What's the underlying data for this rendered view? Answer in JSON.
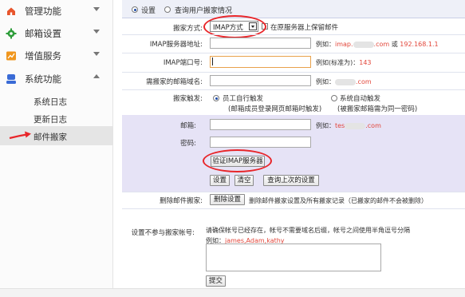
{
  "sidebar": {
    "items": [
      {
        "label": "管理功能",
        "icon": "home-icon",
        "color": "#e8552c"
      },
      {
        "label": "邮箱设置",
        "icon": "gear-icon",
        "color": "#2e9d3a"
      },
      {
        "label": "增值服务",
        "icon": "chart-icon",
        "color": "#f0961d"
      },
      {
        "label": "系统功能",
        "icon": "user-icon",
        "color": "#3a6bd6"
      }
    ],
    "subitems": [
      {
        "label": "系统日志"
      },
      {
        "label": "更新日志"
      },
      {
        "label": "邮件搬家"
      }
    ]
  },
  "tabs": {
    "settings": "设置",
    "query": "查询用户搬家情况"
  },
  "form": {
    "method_label": "搬家方式:",
    "method_value": "IMAP方式",
    "keep_mail_label": "在原服务器上保留邮件",
    "server_label": "IMAP服务器地址:",
    "server_hint_prefix": "例如：",
    "server_hint_example1": "imap.",
    "server_hint_sep": "或",
    "server_hint_example2": "192.168.1.1",
    "port_label": "IMAP端口号:",
    "port_hint_prefix": "例如(标准为)：",
    "port_hint_value": "143",
    "domain_label": "需搬家的邮箱域名:",
    "domain_hint_prefix": "例如：",
    "trigger_label": "搬家触发:",
    "trigger_option1": "员工自行触发",
    "trigger_option1_note": "(邮箱成员登录网页邮箱时触发)",
    "trigger_option2": "系统自动触发",
    "trigger_option2_note": "(被搬家邮箱需为同一密码)",
    "email_label": "邮箱:",
    "email_hint_prefix": "例如：",
    "email_hint_value": "tes",
    "email_hint_suffix": ".com",
    "password_label": "密码:",
    "verify_button": "验证IMAP服务器",
    "set_button": "设置",
    "clear_button": "清空",
    "last_button": "查询上次的设置",
    "delete_label": "删除邮件搬家:",
    "delete_button": "删除设置",
    "delete_note": "删除邮件搬家设置及所有搬家记录（已搬家的邮件不会被删除）",
    "exclude_label": "设置不参与搬家帐号:",
    "exclude_note": "请确保帐号已经存在，帐号不需要域名后缀，帐号之间使用半角逗号分隔",
    "exclude_example_prefix": "例如：",
    "exclude_example_value": "james,Adam,kathy",
    "submit_button": "提交",
    "server_hint_suffix": ".com",
    "domain_hint_suffix": ".com"
  },
  "colors": {
    "accent_red": "#e2463a",
    "highlight_ellipse": "#e8262a",
    "purple_band": "#e6e3f6"
  }
}
